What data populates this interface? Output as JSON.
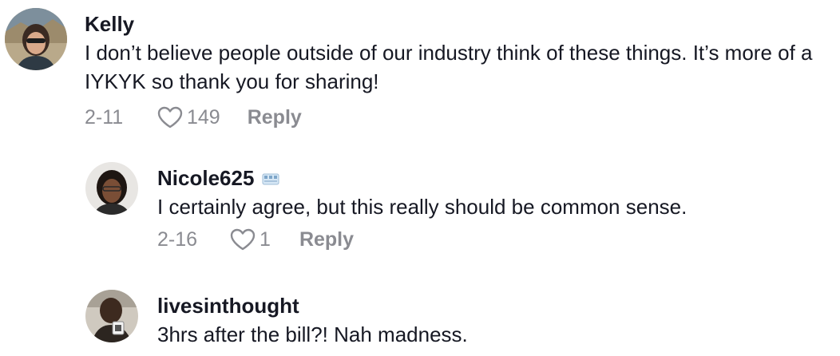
{
  "comments": [
    {
      "username": "Kelly",
      "text": "I don’t believe people outside of our industry think of these things. It’s more of a IYKYK so thank you for sharing!",
      "date": "2-11",
      "likes": "149",
      "reply_label": "Reply",
      "replies": [
        {
          "username": "Nicole625",
          "badge_icon": "emoji-badge-icon",
          "text": "I certainly agree, but this really should be common sense.",
          "date": "2-16",
          "likes": "1",
          "reply_label": "Reply"
        },
        {
          "username": "livesinthought",
          "text": "3hrs after the bill?! Nah madness."
        }
      ]
    }
  ],
  "colors": {
    "primary_text": "#161823",
    "secondary_text": "#8a8b91",
    "background": "#ffffff"
  }
}
